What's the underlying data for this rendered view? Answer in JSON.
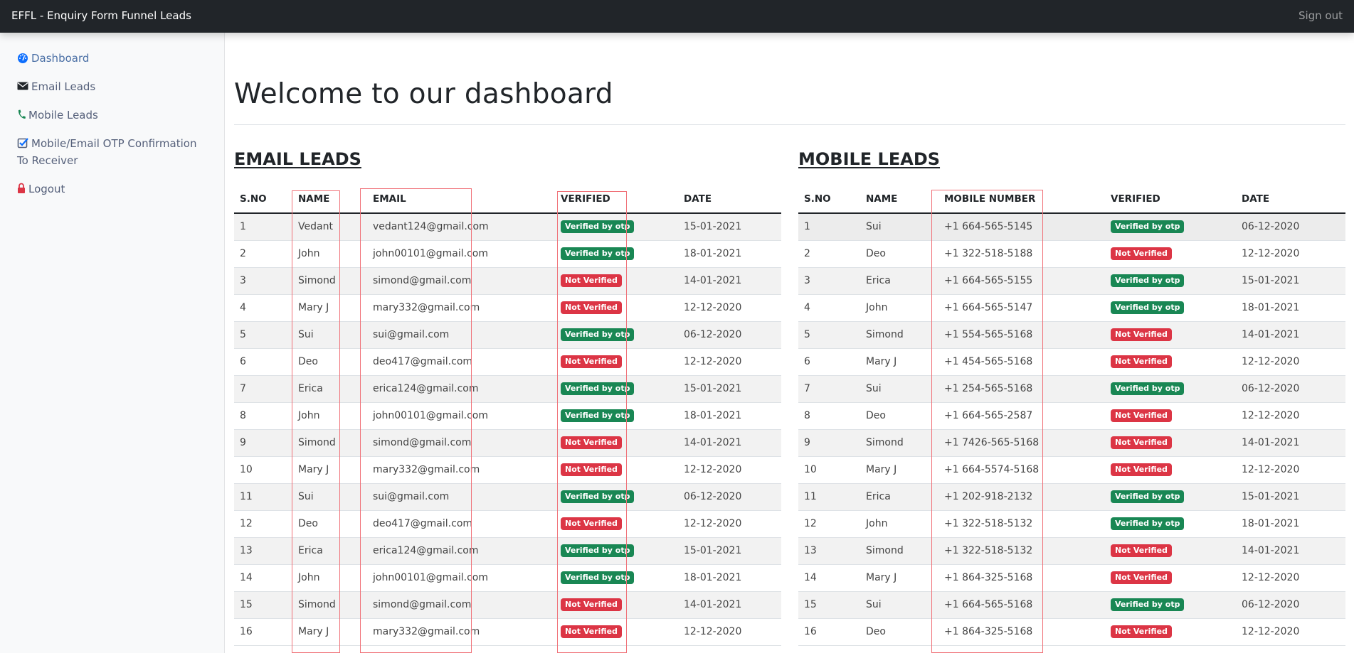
{
  "navbar": {
    "brand": "EFFL - Enquiry Form Funnel Leads",
    "signout": "Sign out"
  },
  "sidebar": {
    "items": [
      {
        "label": "Dashboard",
        "icon": "dashboard-icon",
        "icon_color": "#0d6efd"
      },
      {
        "label": "Email Leads",
        "icon": "envelope-icon",
        "icon_color": "#212529"
      },
      {
        "label": "Mobile Leads",
        "icon": "phone-icon",
        "icon_color": "#198754"
      },
      {
        "label": "Mobile/Email OTP Confirmation To Receiver",
        "icon": "check-square-icon",
        "icon_color": "#0d6efd"
      },
      {
        "label": "Logout",
        "icon": "lock-icon",
        "icon_color": "#dc3545"
      }
    ]
  },
  "main": {
    "title": "Welcome to our dashboard"
  },
  "colors": {
    "verified": "#198754",
    "not_verified": "#dc3545",
    "navbar": "#212529"
  },
  "email_leads": {
    "title": "EMAIL LEADS",
    "columns": [
      "S.NO",
      "NAME",
      "EMAIL",
      "VERIFIED",
      "DATE"
    ],
    "rows": [
      {
        "sno": "1",
        "name": "Vedant",
        "email": "vedant124@gmail.com",
        "verified": "Verified by otp",
        "status": "ok",
        "date": "15-01-2021"
      },
      {
        "sno": "2",
        "name": "John",
        "email": "john00101@gmail.com",
        "verified": "Verified by otp",
        "status": "ok",
        "date": "18-01-2021"
      },
      {
        "sno": "3",
        "name": "Simond",
        "email": "simond@gmail.com",
        "verified": "Not Verified",
        "status": "no",
        "date": "14-01-2021"
      },
      {
        "sno": "4",
        "name": "Mary J",
        "email": "mary332@gmail.com",
        "verified": "Not Verified",
        "status": "no",
        "date": "12-12-2020"
      },
      {
        "sno": "5",
        "name": "Sui",
        "email": "sui@gmail.com",
        "verified": "Verified by otp",
        "status": "ok",
        "date": "06-12-2020"
      },
      {
        "sno": "6",
        "name": "Deo",
        "email": "deo417@gmail.com",
        "verified": "Not Verified",
        "status": "no",
        "date": "12-12-2020"
      },
      {
        "sno": "7",
        "name": "Erica",
        "email": "erica124@gmail.com",
        "verified": "Verified by otp",
        "status": "ok",
        "date": "15-01-2021"
      },
      {
        "sno": "8",
        "name": "John",
        "email": "john00101@gmail.com",
        "verified": "Verified by otp",
        "status": "ok",
        "date": "18-01-2021"
      },
      {
        "sno": "9",
        "name": "Simond",
        "email": "simond@gmail.com",
        "verified": "Not Verified",
        "status": "no",
        "date": "14-01-2021"
      },
      {
        "sno": "10",
        "name": "Mary J",
        "email": "mary332@gmail.com",
        "verified": "Not Verified",
        "status": "no",
        "date": "12-12-2020"
      },
      {
        "sno": "11",
        "name": "Sui",
        "email": "sui@gmail.com",
        "verified": "Verified by otp",
        "status": "ok",
        "date": "06-12-2020"
      },
      {
        "sno": "12",
        "name": "Deo",
        "email": "deo417@gmail.com",
        "verified": "Not Verified",
        "status": "no",
        "date": "12-12-2020"
      },
      {
        "sno": "13",
        "name": "Erica",
        "email": "erica124@gmail.com",
        "verified": "Verified by otp",
        "status": "ok",
        "date": "15-01-2021"
      },
      {
        "sno": "14",
        "name": "John",
        "email": "john00101@gmail.com",
        "verified": "Verified by otp",
        "status": "ok",
        "date": "18-01-2021"
      },
      {
        "sno": "15",
        "name": "Simond",
        "email": "simond@gmail.com",
        "verified": "Not Verified",
        "status": "no",
        "date": "14-01-2021"
      },
      {
        "sno": "16",
        "name": "Mary J",
        "email": "mary332@gmail.com",
        "verified": "Not Verified",
        "status": "no",
        "date": "12-12-2020"
      }
    ]
  },
  "mobile_leads": {
    "title": "MOBILE LEADS",
    "columns": [
      "S.NO",
      "NAME",
      "MOBILE NUMBER",
      "VERIFIED",
      "DATE"
    ],
    "rows": [
      {
        "sno": "1",
        "name": "Sui",
        "mobile": "+1 664-565-5145",
        "verified": "Verified by otp",
        "status": "ok",
        "date": "06-12-2020"
      },
      {
        "sno": "2",
        "name": "Deo",
        "mobile": "+1 322-518-5188",
        "verified": "Not Verified",
        "status": "no",
        "date": "12-12-2020"
      },
      {
        "sno": "3",
        "name": "Erica",
        "mobile": "+1 664-565-5155",
        "verified": "Verified by otp",
        "status": "ok",
        "date": "15-01-2021"
      },
      {
        "sno": "4",
        "name": "John",
        "mobile": "+1 664-565-5147",
        "verified": "Verified by otp",
        "status": "ok",
        "date": "18-01-2021"
      },
      {
        "sno": "5",
        "name": "Simond",
        "mobile": "+1 554-565-5168",
        "verified": "Not Verified",
        "status": "no",
        "date": "14-01-2021"
      },
      {
        "sno": "6",
        "name": "Mary J",
        "mobile": "+1 454-565-5168",
        "verified": "Not Verified",
        "status": "no",
        "date": "12-12-2020"
      },
      {
        "sno": "7",
        "name": "Sui",
        "mobile": "+1 254-565-5168",
        "verified": "Verified by otp",
        "status": "ok",
        "date": "06-12-2020"
      },
      {
        "sno": "8",
        "name": "Deo",
        "mobile": "+1 664-565-2587",
        "verified": "Not Verified",
        "status": "no",
        "date": "12-12-2020"
      },
      {
        "sno": "9",
        "name": "Simond",
        "mobile": "+1 7426-565-5168",
        "verified": "Not Verified",
        "status": "no",
        "date": "14-01-2021"
      },
      {
        "sno": "10",
        "name": "Mary J",
        "mobile": "+1 664-5574-5168",
        "verified": "Not Verified",
        "status": "no",
        "date": "12-12-2020"
      },
      {
        "sno": "11",
        "name": "Erica",
        "mobile": "+1 202-918-2132",
        "verified": "Verified by otp",
        "status": "ok",
        "date": "15-01-2021"
      },
      {
        "sno": "12",
        "name": "John",
        "mobile": "+1 322-518-5132",
        "verified": "Verified by otp",
        "status": "ok",
        "date": "18-01-2021"
      },
      {
        "sno": "13",
        "name": "Simond",
        "mobile": "+1 322-518-5132",
        "verified": "Not Verified",
        "status": "no",
        "date": "14-01-2021"
      },
      {
        "sno": "14",
        "name": "Mary J",
        "mobile": "+1 864-325-5168",
        "verified": "Not Verified",
        "status": "no",
        "date": "12-12-2020"
      },
      {
        "sno": "15",
        "name": "Sui",
        "mobile": "+1 664-565-5168",
        "verified": "Verified by otp",
        "status": "ok",
        "date": "06-12-2020"
      },
      {
        "sno": "16",
        "name": "Deo",
        "mobile": "+1 864-325-5168",
        "verified": "Not Verified",
        "status": "no",
        "date": "12-12-2020"
      }
    ]
  }
}
